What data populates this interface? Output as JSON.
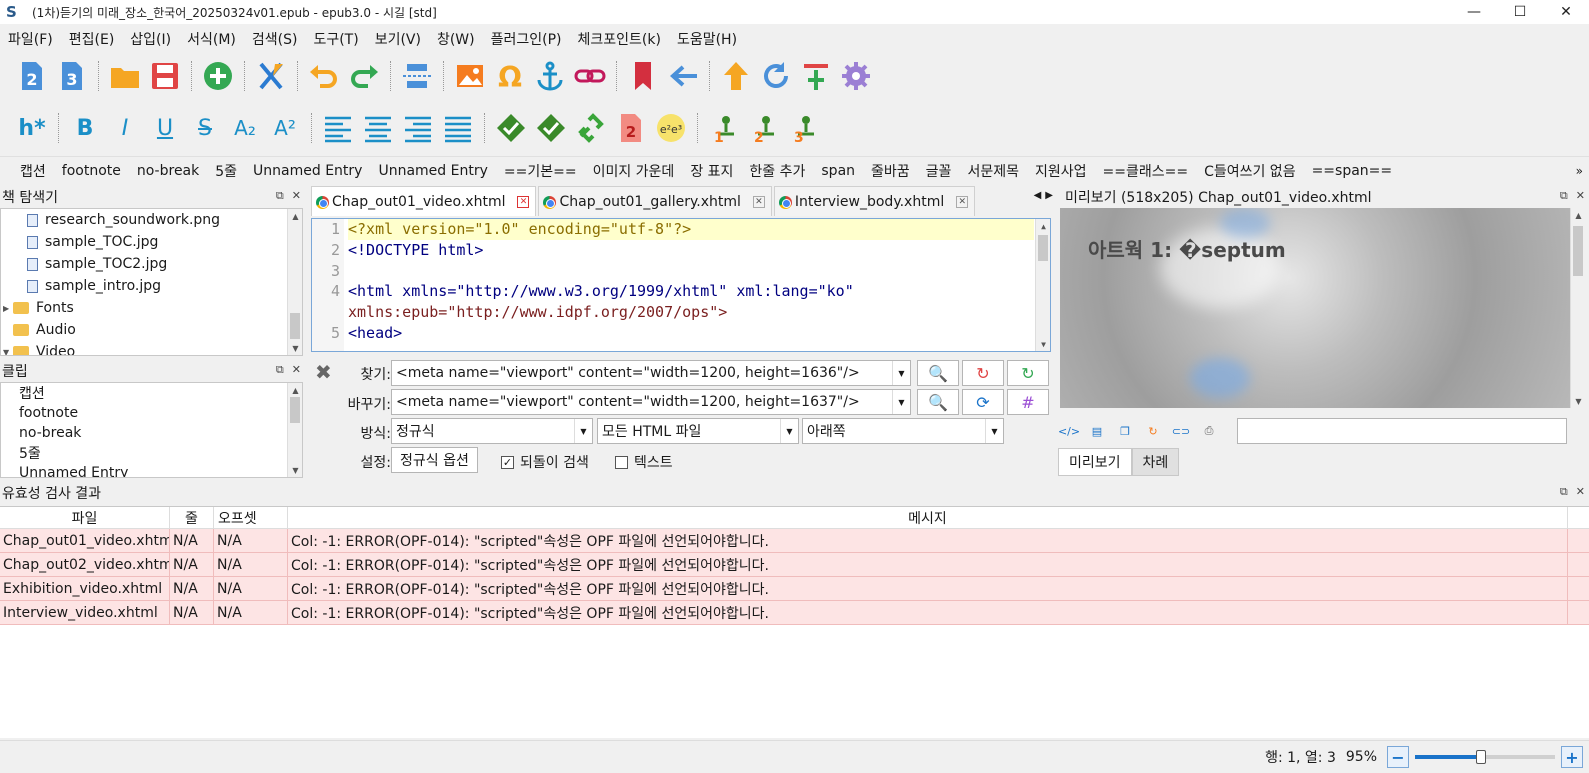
{
  "window": {
    "title": "(1차)듣기의 미래_장소_한국어_20250324v01.epub - epub3.0 - 시길 [std]",
    "app_icon_glyph": "S",
    "minimize": "—",
    "maximize": "☐",
    "close": "✕"
  },
  "menu": [
    "파일(F)",
    "편집(E)",
    "삽입(I)",
    "서식(M)",
    "검색(S)",
    "도구(T)",
    "보기(V)",
    "창(W)",
    "플러그인(P)",
    "체크포인트(k)",
    "도움말(H)"
  ],
  "toolbar2": {
    "heading_label": "h*",
    "bold": "B",
    "italic": "I",
    "underline": "U",
    "strike": "S",
    "sub": "A₂",
    "sup": "A²"
  },
  "cliprow": {
    "items": [
      "캡션",
      "footnote",
      "no-break",
      "5줄",
      "Unnamed Entry",
      "Unnamed Entry",
      "==기본==",
      "이미지 가운데",
      "장 표지",
      "한줄 추가",
      "span",
      "줄바꿈",
      "글꼴",
      "서문제목",
      "지원사업",
      "==클래스==",
      "C들여쓰기 없음",
      "==span=="
    ],
    "more": "»"
  },
  "book_nav": {
    "title": "책 탐색기",
    "items": [
      {
        "label": "research_soundwork.png",
        "type": "file"
      },
      {
        "label": "sample_TOC.jpg",
        "type": "file"
      },
      {
        "label": "sample_TOC2.jpg",
        "type": "file"
      },
      {
        "label": "sample_intro.jpg",
        "type": "file"
      },
      {
        "label": "Fonts",
        "type": "folder"
      },
      {
        "label": "Audio",
        "type": "folder"
      },
      {
        "label": "Video",
        "type": "folder"
      }
    ]
  },
  "clips_panel": {
    "title": "클립",
    "items": [
      "캡션",
      "footnote",
      "no-break",
      "5줄",
      "Unnamed Entry"
    ]
  },
  "editor": {
    "tabs": [
      "Chap_out01_video.xhtml",
      "Chap_out01_gallery.xhtml",
      "Interview_body.xhtml"
    ],
    "line_numbers": [
      "1",
      "2",
      "3",
      "4",
      "",
      "5"
    ],
    "lines": [
      "<?xml version=\"1.0\" encoding=\"utf-8\"?>",
      "<!DOCTYPE html>",
      "",
      "<html xmlns=\"http://www.w3.org/1999/xhtml\" xml:lang=\"ko\"",
      "xmlns:epub=\"http://www.idpf.org/2007/ops\">",
      "<head>"
    ]
  },
  "find": {
    "find_label": "찾기:",
    "find_value": "<meta name=\"viewport\" content=\"width=1200, height=1636\"/>",
    "replace_label": "바꾸기:",
    "replace_value": "<meta name=\"viewport\" content=\"width=1200, height=1637\"/>",
    "mode_label": "방식:",
    "mode_value": "정규식",
    "scope_value": "모든 HTML 파일",
    "direction_value": "아래쪽",
    "settings_label": "설정:",
    "regex_options": "정규식 옵션",
    "wrap_label": "되돌이 검색",
    "text_label": "텍스트",
    "wrap_checked": true,
    "text_checked": false
  },
  "preview": {
    "title": "미리보기 (518x205) Chap_out01_video.xhtml",
    "heading": "아트웍 1: �septum",
    "tabs": [
      "미리보기",
      "차례"
    ]
  },
  "results": {
    "title": "유효성 검사 결과",
    "headers": [
      "파일",
      "줄",
      "오프셋",
      "메시지"
    ],
    "rows": [
      {
        "file": "Chap_out01_video.xhtml",
        "line": "N/A",
        "offset": "N/A",
        "message": "Col: -1: ERROR(OPF-014): \"scripted\"속성은 OPF 파일에 선언되어야합니다."
      },
      {
        "file": "Chap_out02_video.xhtml",
        "line": "N/A",
        "offset": "N/A",
        "message": "Col: -1: ERROR(OPF-014): \"scripted\"속성은 OPF 파일에 선언되어야합니다."
      },
      {
        "file": "Exhibition_video.xhtml",
        "line": "N/A",
        "offset": "N/A",
        "message": "Col: -1: ERROR(OPF-014): \"scripted\"속성은 OPF 파일에 선언되어야합니다."
      },
      {
        "file": "Interview_video.xhtml",
        "line": "N/A",
        "offset": "N/A",
        "message": "Col: -1: ERROR(OPF-014): \"scripted\"속성은 OPF 파일에 선언되어야합니다."
      }
    ]
  },
  "status": {
    "position": "행: 1, 열: 3",
    "zoom": "95%",
    "zoom_fraction": 0.47
  }
}
